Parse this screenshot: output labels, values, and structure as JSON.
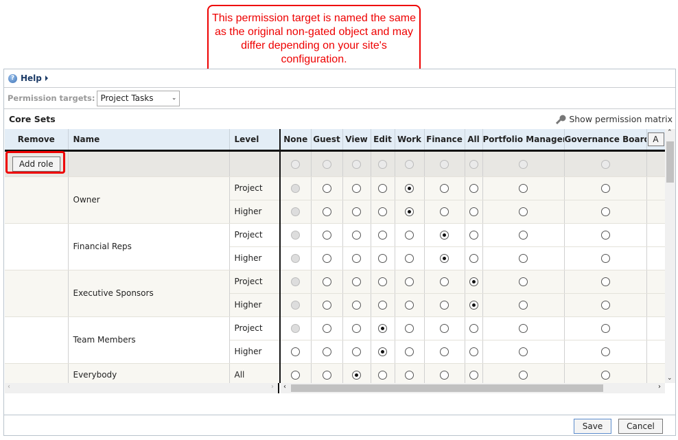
{
  "callout": {
    "text": "This permission target is named the same as the original non-gated object and may differ depending on your site's configuration."
  },
  "help": {
    "label": "Help"
  },
  "permission_targets": {
    "label": "Permission targets:",
    "value": "Project Tasks"
  },
  "core_sets": {
    "title": "Core Sets",
    "matrix_link": "Show permission matrix"
  },
  "columns": [
    "Remove",
    "Name",
    "Level",
    "None",
    "Guest",
    "View",
    "Edit",
    "Work",
    "Finance",
    "All",
    "Portfolio Manager",
    "Governance Board"
  ],
  "extra_column_button": "A",
  "add_role_label": "Add role",
  "rows": [
    {
      "name": "Owner",
      "levels": [
        {
          "level": "Project",
          "selected": "Work"
        },
        {
          "level": "Higher",
          "selected": "Work"
        }
      ],
      "none_disabled": [
        true,
        true
      ]
    },
    {
      "name": "Financial Reps",
      "levels": [
        {
          "level": "Project",
          "selected": "Finance"
        },
        {
          "level": "Higher",
          "selected": "Finance"
        }
      ],
      "none_disabled": [
        true,
        true
      ]
    },
    {
      "name": "Executive Sponsors",
      "levels": [
        {
          "level": "Project",
          "selected": "All"
        },
        {
          "level": "Higher",
          "selected": "All"
        }
      ],
      "none_disabled": [
        true,
        true
      ]
    },
    {
      "name": "Team Members",
      "levels": [
        {
          "level": "Project",
          "selected": "Edit"
        },
        {
          "level": "Higher",
          "selected": "Edit"
        }
      ],
      "none_disabled": [
        true,
        false
      ]
    },
    {
      "name": "Everybody",
      "levels": [
        {
          "level": "All",
          "selected": "View"
        }
      ],
      "none_disabled": [
        false
      ]
    }
  ],
  "footer": {
    "save": "Save",
    "cancel": "Cancel"
  },
  "colors": {
    "accent_red": "#e00000",
    "header_bg": "#e3edf6"
  }
}
